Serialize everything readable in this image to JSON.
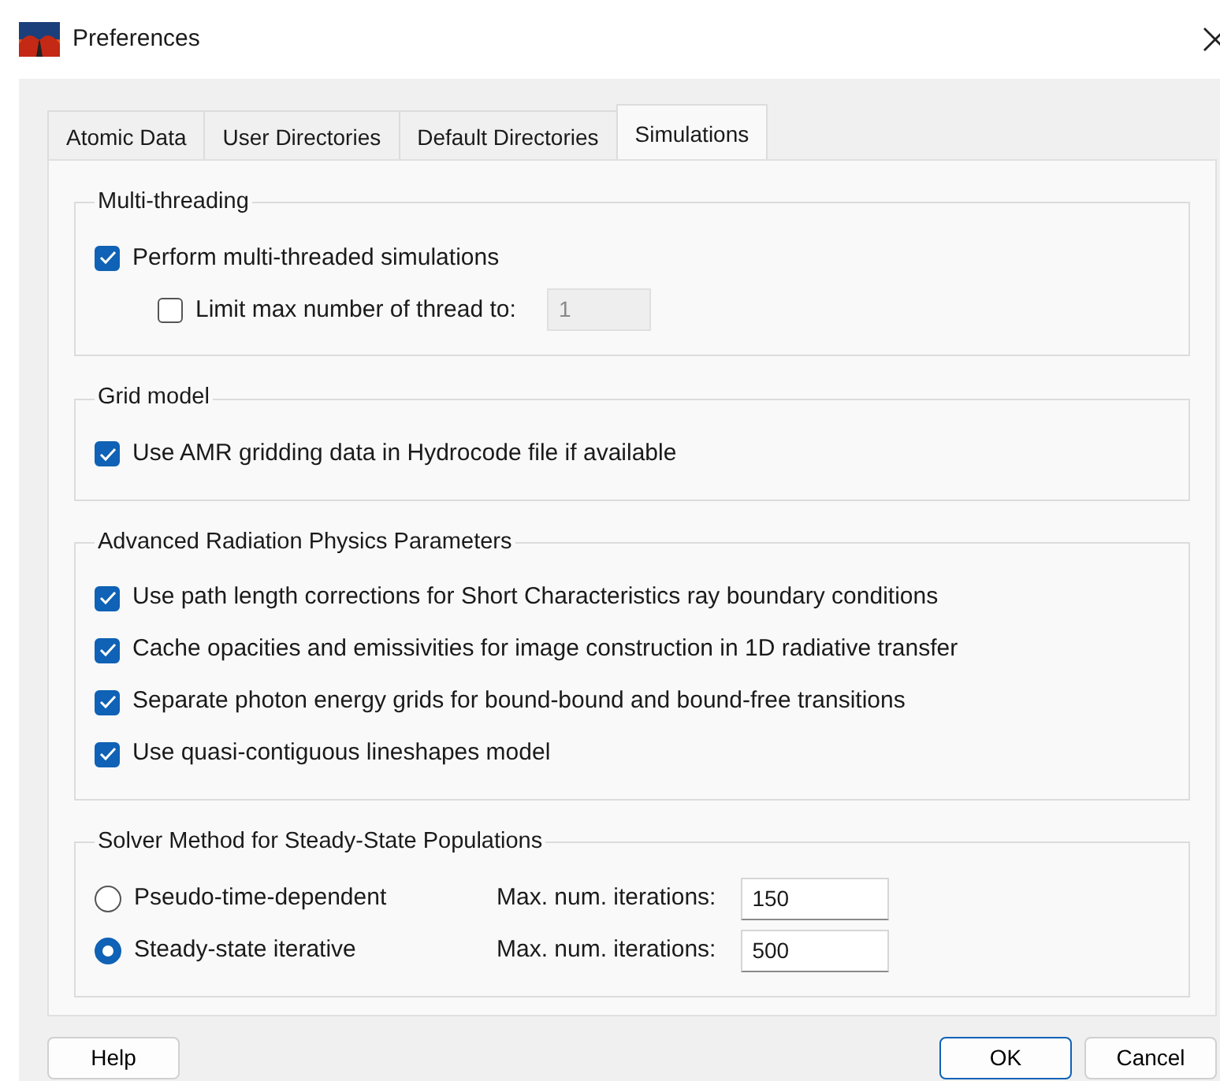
{
  "window": {
    "title": "Preferences"
  },
  "tabs": [
    {
      "label": "Atomic Data",
      "selected": false
    },
    {
      "label": "User Directories",
      "selected": false
    },
    {
      "label": "Default Directories",
      "selected": false
    },
    {
      "label": "Simulations",
      "selected": true
    }
  ],
  "groups": [
    {
      "title": "Multi-threading",
      "items": [
        {
          "kind": "checkbox",
          "label": "Perform multi-threaded simulations",
          "checked": true,
          "children": [
            {
              "kind": "checkbox",
              "label": "Limit max number of thread to:",
              "checked": false,
              "field": {
                "value": "1",
                "disabled": true
              }
            }
          ]
        }
      ]
    },
    {
      "title": "Grid model",
      "items": [
        {
          "kind": "checkbox",
          "label": "Use AMR gridding data in Hydrocode file if available",
          "checked": true
        }
      ]
    },
    {
      "title": "Advanced Radiation Physics Parameters",
      "items": [
        {
          "kind": "checkbox",
          "label": "Use path length corrections for Short Characteristics ray boundary conditions",
          "checked": true
        },
        {
          "kind": "checkbox",
          "label": "Cache opacities and emissivities for image construction in 1D radiative transfer",
          "checked": true
        },
        {
          "kind": "checkbox",
          "label": "Separate photon energy grids for bound-bound and bound-free transitions",
          "checked": true
        },
        {
          "kind": "checkbox",
          "label": "Use quasi-contiguous lineshapes model",
          "checked": true
        }
      ]
    },
    {
      "title": "Solver Method for Steady-State Populations",
      "items": [
        {
          "kind": "radio",
          "label": "Pseudo-time-dependent",
          "selected": false,
          "field_label": "Max. num. iterations:",
          "field": {
            "value": "150",
            "disabled": false
          }
        },
        {
          "kind": "radio",
          "label": "Steady-state iterative",
          "selected": true,
          "field_label": "Max. num. iterations:",
          "field": {
            "value": "500",
            "disabled": false
          }
        }
      ]
    }
  ],
  "buttons": [
    {
      "label": "Help",
      "default": false
    },
    {
      "label": "OK",
      "default": true
    },
    {
      "label": "Cancel",
      "default": false
    }
  ]
}
